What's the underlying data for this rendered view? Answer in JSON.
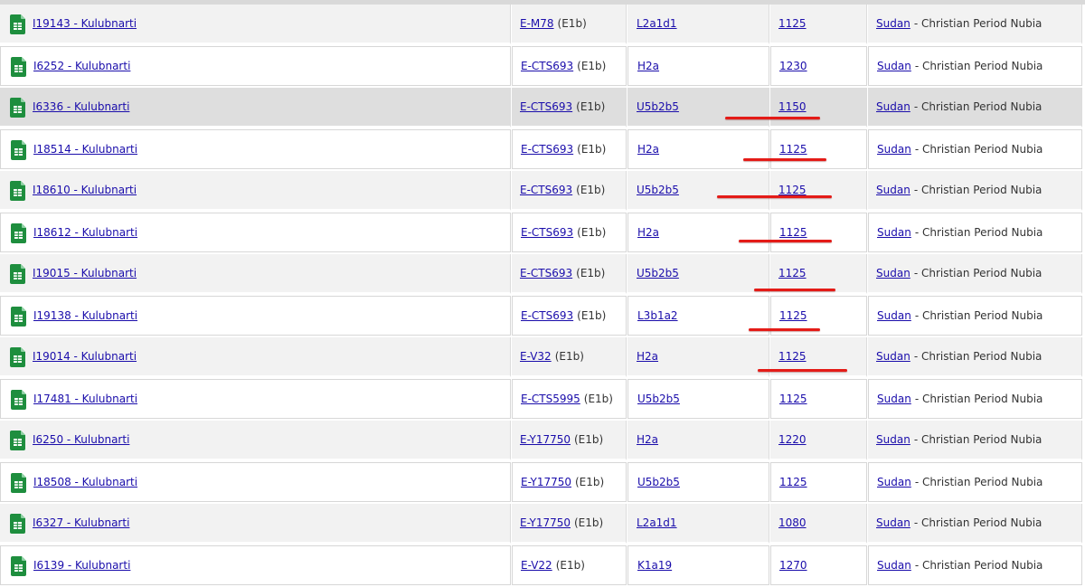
{
  "colors": {
    "link": "#1a0dab",
    "row_alt": "#f2f2f2",
    "row_highlight": "#dedede",
    "annotation": "#e41b17",
    "sheet_icon": "#1e8e3e"
  },
  "icon": "google-sheets-icon",
  "rows": [
    {
      "sample": "I19143 - Kulubnarti",
      "ydna": "E-M78",
      "ydna_group": "(E1b)",
      "mtdna": "L2a1d1",
      "date": "1125",
      "country": "Sudan",
      "culture": "- Christian Period Nubia",
      "style": "alt",
      "annotated": false
    },
    {
      "sample": "I6252 - Kulubnarti",
      "ydna": "E-CTS693",
      "ydna_group": "(E1b)",
      "mtdna": "H2a",
      "date": "1230",
      "country": "Sudan",
      "culture": "- Christian Period Nubia",
      "style": "white",
      "annotated": false
    },
    {
      "sample": "I6336 - Kulubnarti",
      "ydna": "E-CTS693",
      "ydna_group": "(E1b)",
      "mtdna": "U5b2b5",
      "date": "1150",
      "country": "Sudan",
      "culture": "- Christian Period Nubia",
      "style": "highlight",
      "annotated": true
    },
    {
      "sample": "I18514 - Kulubnarti",
      "ydna": "E-CTS693",
      "ydna_group": "(E1b)",
      "mtdna": "H2a",
      "date": "1125",
      "country": "Sudan",
      "culture": "- Christian Period Nubia",
      "style": "white",
      "annotated": true
    },
    {
      "sample": "I18610 - Kulubnarti",
      "ydna": "E-CTS693",
      "ydna_group": "(E1b)",
      "mtdna": "U5b2b5",
      "date": "1125",
      "country": "Sudan",
      "culture": "- Christian Period Nubia",
      "style": "alt",
      "annotated": true
    },
    {
      "sample": "I18612 - Kulubnarti",
      "ydna": "E-CTS693",
      "ydna_group": "(E1b)",
      "mtdna": "H2a",
      "date": "1125",
      "country": "Sudan",
      "culture": "- Christian Period Nubia",
      "style": "white",
      "annotated": true
    },
    {
      "sample": "I19015 - Kulubnarti",
      "ydna": "E-CTS693",
      "ydna_group": "(E1b)",
      "mtdna": "U5b2b5",
      "date": "1125",
      "country": "Sudan",
      "culture": "- Christian Period Nubia",
      "style": "alt",
      "annotated": true
    },
    {
      "sample": "I19138 - Kulubnarti",
      "ydna": "E-CTS693",
      "ydna_group": "(E1b)",
      "mtdna": "L3b1a2",
      "date": "1125",
      "country": "Sudan",
      "culture": "- Christian Period Nubia",
      "style": "white",
      "annotated": true
    },
    {
      "sample": "I19014 - Kulubnarti",
      "ydna": "E-V32",
      "ydna_group": "(E1b)",
      "mtdna": "H2a",
      "date": "1125",
      "country": "Sudan",
      "culture": "- Christian Period Nubia",
      "style": "alt",
      "annotated": true
    },
    {
      "sample": "I17481 - Kulubnarti",
      "ydna": "E-CTS5995",
      "ydna_group": "(E1b)",
      "mtdna": "U5b2b5",
      "date": "1125",
      "country": "Sudan",
      "culture": "- Christian Period Nubia",
      "style": "white",
      "annotated": false
    },
    {
      "sample": "I6250 - Kulubnarti",
      "ydna": "E-Y17750",
      "ydna_group": "(E1b)",
      "mtdna": "H2a",
      "date": "1220",
      "country": "Sudan",
      "culture": "- Christian Period Nubia",
      "style": "alt",
      "annotated": false
    },
    {
      "sample": "I18508 - Kulubnarti",
      "ydna": "E-Y17750",
      "ydna_group": "(E1b)",
      "mtdna": "U5b2b5",
      "date": "1125",
      "country": "Sudan",
      "culture": "- Christian Period Nubia",
      "style": "white",
      "annotated": false
    },
    {
      "sample": "I6327 - Kulubnarti",
      "ydna": "E-Y17750",
      "ydna_group": "(E1b)",
      "mtdna": "L2a1d1",
      "date": "1080",
      "country": "Sudan",
      "culture": "- Christian Period Nubia",
      "style": "alt",
      "annotated": false
    },
    {
      "sample": "I6139 - Kulubnarti",
      "ydna": "E-V22",
      "ydna_group": "(E1b)",
      "mtdna": "K1a19",
      "date": "1270",
      "country": "Sudan",
      "culture": "- Christian Period Nubia",
      "style": "white",
      "annotated": false
    }
  ]
}
